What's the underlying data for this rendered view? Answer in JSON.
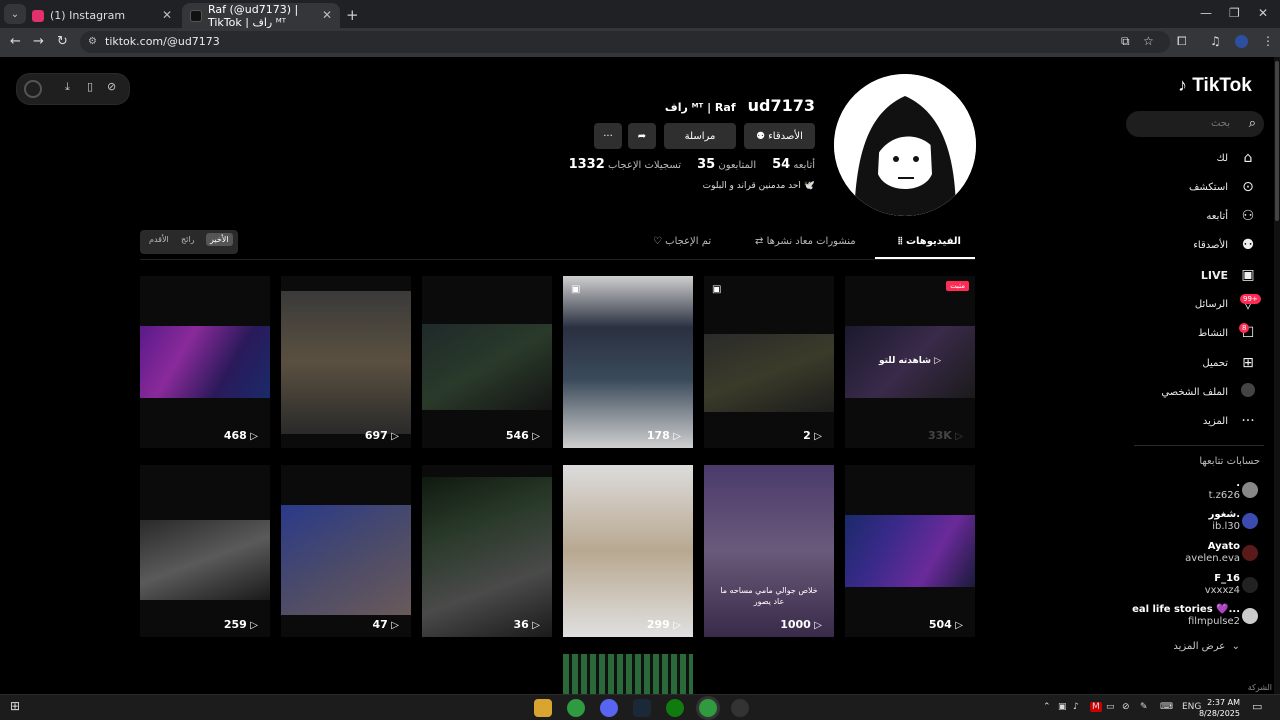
{
  "browser": {
    "tabs": [
      {
        "title": "(1) Instagram",
        "favicon_color": "#e1306c"
      },
      {
        "title": "Raf (@ud7173) | TikTok | راف ᴹᵀ",
        "favicon_color": "#000000"
      }
    ],
    "url": "tiktok.com/@ud7173"
  },
  "sidebar": {
    "logo": "TikTok",
    "search_placeholder": "بحث",
    "items": [
      {
        "label": "لك",
        "icon": "home-icon"
      },
      {
        "label": "استكشف",
        "icon": "compass-icon"
      },
      {
        "label": "أتابعه",
        "icon": "following-icon"
      },
      {
        "label": "الأصدقاء",
        "icon": "friends-icon"
      },
      {
        "label": "LIVE",
        "icon": "live-icon"
      },
      {
        "label": "الرسائل",
        "icon": "messages-icon",
        "badge": "99+"
      },
      {
        "label": "النشاط",
        "icon": "activity-icon",
        "badge": "8"
      },
      {
        "label": "تحميل",
        "icon": "upload-icon"
      },
      {
        "label": "الملف الشخصي",
        "icon": "profile-icon"
      },
      {
        "label": "المزيد",
        "icon": "more-icon"
      }
    ],
    "following_title": "حسابات تتابعها",
    "following": [
      {
        "name": ".",
        "handle": "t.z626",
        "color": "#888888"
      },
      {
        "name": "شغور.",
        "handle": "ib.l30",
        "color": "#3b4bb0"
      },
      {
        "name": "Ayato",
        "handle": "avelen.eva",
        "color": "#5a1a1a"
      },
      {
        "name": "F_16",
        "handle": "vxxxz4",
        "color": "#222222"
      },
      {
        "name": "eal life stories 💜...",
        "handle": "filmpulse2",
        "color": "#cccccc"
      }
    ],
    "see_more": "عرض المزيد",
    "company": "الشركة"
  },
  "profile": {
    "username": "ud7173",
    "display_name": "راف ᴹᵀ | Raf",
    "buttons": {
      "friends": "الأصدقاء",
      "message": "مراسلة"
    },
    "stats": [
      {
        "label": "أتابعه",
        "value": "54"
      },
      {
        "label": "المتابعون",
        "value": "35"
      },
      {
        "label": "تسجيلات الإعجاب",
        "value": "1332"
      }
    ],
    "bio": "احد مدمنين قراند و البلوت 🕊️"
  },
  "profile_tabs": [
    {
      "label": "الفيديوهات",
      "icon": "grid-icon",
      "active": true
    },
    {
      "label": "منشورات معاد نشرها",
      "icon": "repost-icon",
      "active": false
    },
    {
      "label": "تم الإعجاب",
      "icon": "liked-icon",
      "active": false
    }
  ],
  "sort": [
    "الأخير",
    "رائج",
    "الأقدم"
  ],
  "videos_row1": [
    {
      "views": "33K",
      "label": "مثبت",
      "caption": "شاهدته للتو ▷"
    },
    {
      "views": "2"
    },
    {
      "views": "178"
    },
    {
      "views": "546"
    },
    {
      "views": "697"
    },
    {
      "views": "468"
    }
  ],
  "videos_row2": [
    {
      "views": "504"
    },
    {
      "views": "1000",
      "caption": "خلاص جوالي مامي مساحه ما عاد يصور"
    },
    {
      "views": "299"
    },
    {
      "views": "36"
    },
    {
      "views": "47"
    },
    {
      "views": "259"
    }
  ],
  "taskbar": {
    "lang": "ENG",
    "time": "2:37 AM",
    "date": "8/28/2025"
  }
}
